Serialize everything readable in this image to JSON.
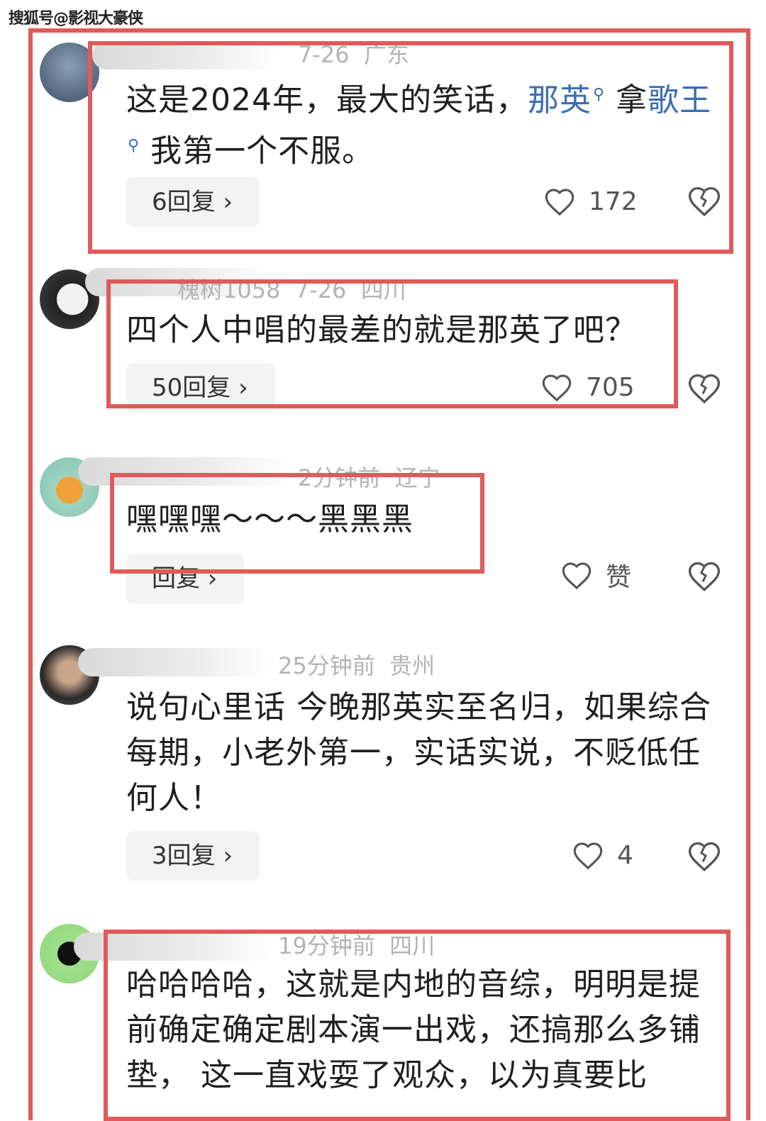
{
  "watermark": "搜狐号@影视大豪侠",
  "comments": [
    {
      "meta": "7-26  广东",
      "text_pre": "这是2024年，最大的笑话，",
      "link1": "那英",
      "text_mid": "拿",
      "link2": "歌王",
      "text_post": "我第一个不服。",
      "replies": "6回复 ›",
      "likes": "172"
    },
    {
      "meta": "槐树1058  7-26  四川",
      "text": "四个人中唱的最差的就是那英了吧？",
      "replies": "50回复 ›",
      "likes": "705"
    },
    {
      "meta": "2分钟前  辽宁",
      "text": "嘿嘿嘿～～～黑黑黑",
      "replies": "回复 ›",
      "likes": "赞"
    },
    {
      "meta": "25分钟前  贵州",
      "text": "说句心里话 今晚那英实至名归，如果综合每期，小老外第一，实话实说，不贬低任何人！",
      "replies": "3回复 ›",
      "likes": "4"
    },
    {
      "meta": "19分钟前  四川",
      "text": "哈哈哈哈，这就是内地的音综，明明是提前确定确定剧本演一出戏，还搞那么多铺垫， 这一直戏耍了观众，以为真要比"
    }
  ],
  "colors": {
    "highlight_box": "#e05a5a",
    "link": "#3a6db5"
  },
  "icons": {
    "like": "heart-outline-icon",
    "dislike": "broken-heart-icon",
    "search": "search-icon"
  }
}
